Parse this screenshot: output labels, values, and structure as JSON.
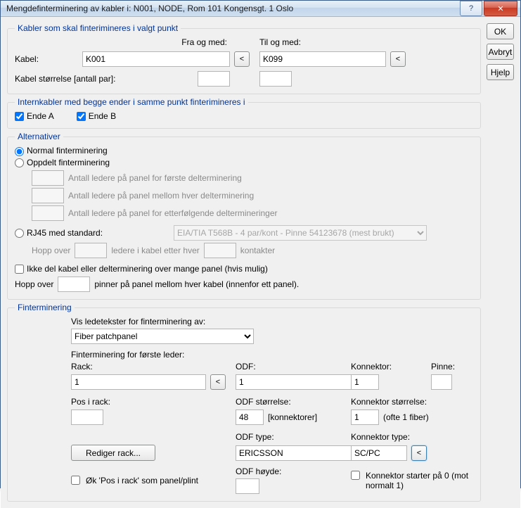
{
  "window": {
    "title": "Mengdefinterminering av kabler i: N001, NODE, Rom 101 Kongensgt. 1 Oslo"
  },
  "buttons": {
    "ok": "OK",
    "avbryt": "Avbryt",
    "hjelp": "Hjelp",
    "help_icon": "?",
    "close_icon": "✕",
    "arrow": "<"
  },
  "group1": {
    "legend": "Kabler som skal finterimineres i valgt punkt",
    "fra_og_med": "Fra og med:",
    "til_og_med": "Til og med:",
    "kabel_label": "Kabel:",
    "kabel_fra": "K001",
    "kabel_til": "K099",
    "storrelse_label": "Kabel størrelse [antall par]:",
    "storrelse_fra": "",
    "storrelse_til": ""
  },
  "group2": {
    "legend": "Internkabler med begge ender i samme punkt finterimineres i",
    "ende_a": "Ende A",
    "ende_b": "Ende B"
  },
  "group3": {
    "legend": "Alternativer",
    "normal": "Normal finterminering",
    "oppdelt": "Oppdelt finterminering",
    "sub1_label": "Antall ledere på panel for første delterminering",
    "sub2_label": "Antall ledere på panel mellom hver delterminering",
    "sub3_label": "Antall ledere på panel for etterfølgende deltermineringer",
    "rj45_label": "RJ45 med standard:",
    "rj45_select": "EIA/TIA T568B - 4 par/kont - Pinne 54123678 (mest brukt)",
    "rj45_hop_pre": "Hopp over",
    "rj45_hop_mid": "ledere i kabel etter hver",
    "rj45_hop_suf": "kontakter",
    "ikke_del": "Ikke del kabel eller delterminering over mange panel (hvis mulig)",
    "hopp2_pre": "Hopp over",
    "hopp2_suf": "pinner på panel mellom hver kabel (innenfor ett panel).",
    "hopp2_val": ""
  },
  "group4": {
    "legend": "Finterminering",
    "vis_label": "Vis ledetekster for finterminering av:",
    "vis_select": "Fiber patchpanel",
    "first_leder": "Finterminering for første leder:",
    "rack_label": "Rack:",
    "rack_val": "1",
    "odf_label": "ODF:",
    "odf_val": "1",
    "konnektor_label": "Konnektor:",
    "konnektor_val": "1",
    "pinne_label": "Pinne:",
    "pinne_val": "",
    "pos_label": "Pos i rack:",
    "pos_val": "",
    "odf_storr_label": "ODF størrelse:",
    "odf_storr_val": "48",
    "odf_storr_suf": "[konnektorer]",
    "konn_storr_label": "Konnektor størrelse:",
    "konn_storr_val": "1",
    "konn_storr_suf": "(ofte 1 fiber)",
    "odf_type_label": "ODF type:",
    "odf_type_val": "ERICSSON",
    "konn_type_label": "Konnektor type:",
    "konn_type_val": "SC/PC",
    "rediger": "Rediger rack...",
    "odf_hoyde_label": "ODF høyde:",
    "odf_hoyde_val": "",
    "ok_pos": "Øk 'Pos i rack' som panel/plint",
    "konn_start": "Konnektor starter på 0 (mot normalt 1)"
  }
}
